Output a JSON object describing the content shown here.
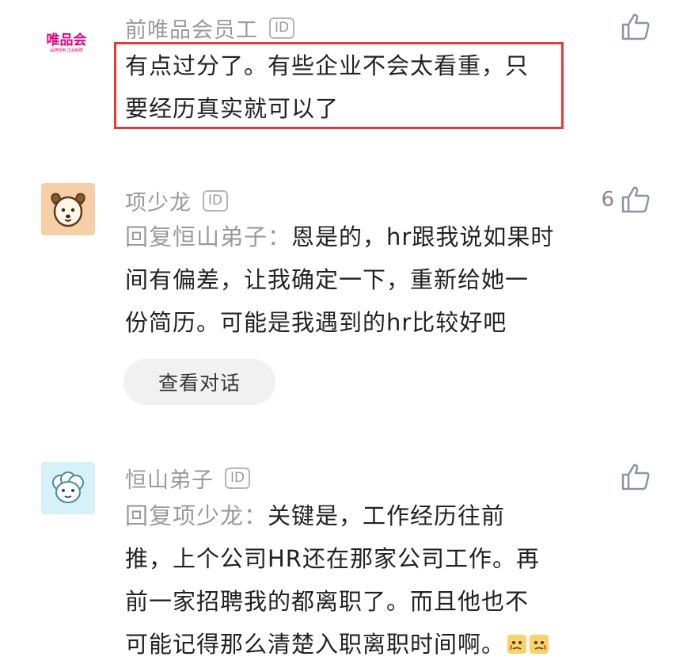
{
  "comments": [
    {
      "author": "前唯品会员工",
      "id_badge": "ID",
      "avatar_logo_text": "唯品会",
      "avatar_logo_sub": "品牌特卖 正品保障",
      "body_lines": [
        "有点过分了。有些企业不会太看重，只",
        "要经历真实就可以了"
      ],
      "likes": ""
    },
    {
      "author": "项少龙",
      "id_badge": "ID",
      "reply_prefix": "回复恒山弟子：",
      "body_lines": [
        "恩是的，hr跟我说如果时",
        "间有偏差，让我确定一下，重新给她一",
        "份简历。可能是我遇到的hr比较好吧"
      ],
      "likes": "6",
      "view_conversation": "查看对话"
    },
    {
      "author": "恒山弟子",
      "id_badge": "ID",
      "reply_prefix": "回复项少龙：",
      "body_lines": [
        "关键是，工作经历往前",
        "推，上个公司HR还在那家公司工作。再",
        "前一家招聘我的都离职了。而且他也不",
        "可能记得那么清楚入职离职时间啊。"
      ],
      "likes": ""
    }
  ],
  "colors": {
    "highlight": "#e23b3b",
    "meta": "#9a9a9a",
    "brand": "#e4007f"
  },
  "icons": [
    "thumbs-up-icon",
    "dog-avatar-icon",
    "sheep-avatar-icon",
    "crying-face-emoji"
  ]
}
